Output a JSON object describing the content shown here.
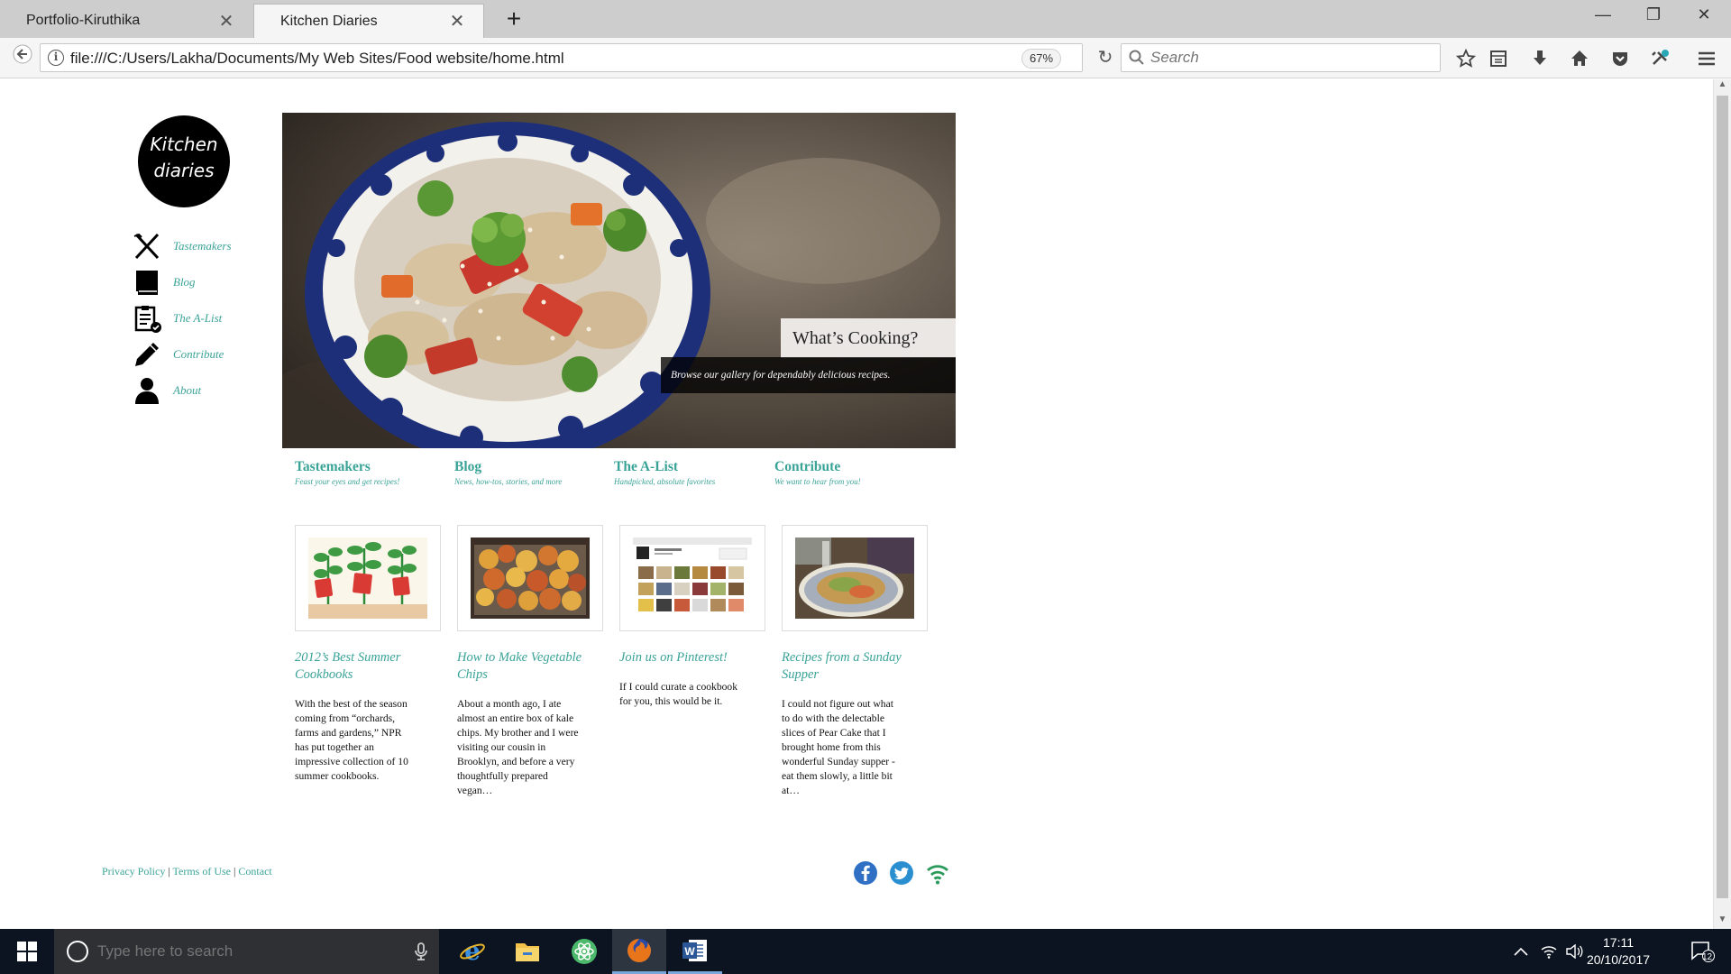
{
  "browser": {
    "tabs": [
      {
        "label": "Portfolio-Kiruthika",
        "active": false
      },
      {
        "label": "Kitchen Diaries",
        "active": true
      }
    ],
    "url": "file:///C:/Users/Lakha/Documents/My Web Sites/Food website/home.html",
    "zoom": "67%",
    "search_placeholder": "Search"
  },
  "site": {
    "logo_line1": "Kitchen",
    "logo_line2": "diaries",
    "nav": [
      {
        "label": "Tastemakers",
        "icon": "fork-knife-icon"
      },
      {
        "label": "Blog",
        "icon": "book-icon"
      },
      {
        "label": "The A-List",
        "icon": "clipboard-check-icon"
      },
      {
        "label": "Contribute",
        "icon": "pencil-icon"
      },
      {
        "label": "About",
        "icon": "person-icon"
      }
    ],
    "hero": {
      "title": "What’s Cooking?",
      "subtitle": "Browse our gallery for dependably delicious recipes."
    },
    "categories": [
      {
        "title": "Tastemakers",
        "subtitle": "Feast your eyes and get recipes!"
      },
      {
        "title": "Blog",
        "subtitle": "News, how-tos, stories, and more"
      },
      {
        "title": "The A-List",
        "subtitle": "Handpicked, absolute favorites"
      },
      {
        "title": "Contribute",
        "subtitle": "We want to hear from you!"
      }
    ],
    "cards": [
      {
        "title": "2012’s Best Summer Cookbooks",
        "text": "With the best of the season coming from “orchards, farms and gardens,” NPR has put together an impressive collection of 10 summer cookbooks."
      },
      {
        "title": "How to Make Vegetable Chips",
        "text": "About a month ago, I ate almost an entire box of kale chips. My brother and I were visiting our cousin in Brooklyn, and before a very thoughtfully prepared vegan…"
      },
      {
        "title": "Join us on Pinterest!",
        "text": "If I could curate a cookbook for you, this would be it."
      },
      {
        "title": "Recipes from a Sunday Supper",
        "text": "I could not figure out what to do with the delectable slices of Pear Cake that I brought home from this wonderful Sunday supper - eat them slowly, a little bit at…"
      }
    ],
    "footer": {
      "links": [
        "Privacy Policy",
        "Terms of Use",
        "Contact"
      ],
      "separator": "|"
    },
    "social": [
      "facebook-icon",
      "twitter-icon",
      "rss-icon"
    ]
  },
  "taskbar": {
    "search_placeholder": "Type here to search",
    "time": "17:11",
    "date": "20/10/2017",
    "notifications": "12"
  },
  "colors": {
    "accent": "#3aa398",
    "tabbar": "#cdcdcd",
    "taskbar": "#0b1420"
  }
}
